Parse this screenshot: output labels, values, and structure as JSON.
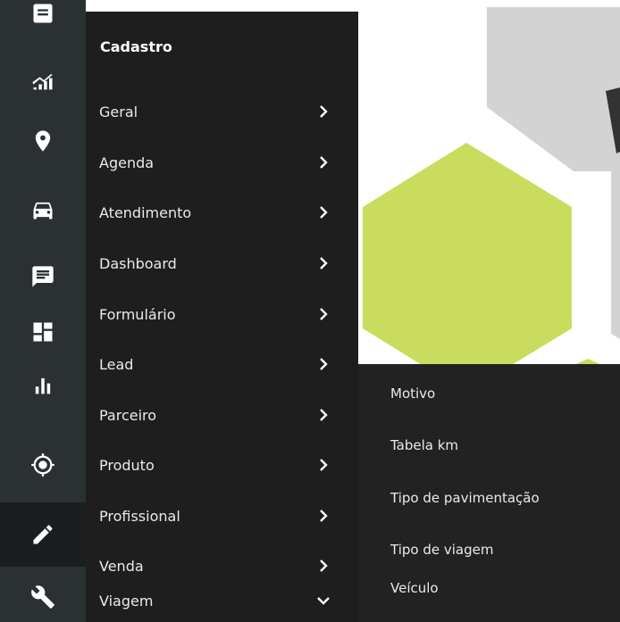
{
  "colors": {
    "rail_bg": "#2b3033",
    "rail_active": "#1b1e20",
    "menu_bg": "#1e1e1e",
    "flyout_bg": "#222222",
    "hex_gray": "#d3d3d3",
    "hex_green": "#c9dc5e",
    "hex_dark": "#333333"
  },
  "rail": {
    "items": [
      {
        "icon": "document-icon"
      },
      {
        "icon": "signal-icon"
      },
      {
        "icon": "map-pin-icon"
      },
      {
        "icon": "car-icon"
      },
      {
        "icon": "chat-icon"
      },
      {
        "icon": "dashboard-icon"
      },
      {
        "icon": "bar-chart-icon"
      },
      {
        "icon": "target-icon"
      },
      {
        "icon": "pencil-icon",
        "active": true
      },
      {
        "icon": "wrench-icon"
      }
    ]
  },
  "menu": {
    "title": "Cadastro",
    "items": [
      {
        "label": "Geral",
        "chevron": "right"
      },
      {
        "label": "Agenda",
        "chevron": "right"
      },
      {
        "label": "Atendimento",
        "chevron": "right"
      },
      {
        "label": "Dashboard",
        "chevron": "right"
      },
      {
        "label": "Formulário",
        "chevron": "right"
      },
      {
        "label": "Lead",
        "chevron": "right"
      },
      {
        "label": "Parceiro",
        "chevron": "right"
      },
      {
        "label": "Produto",
        "chevron": "right"
      },
      {
        "label": "Profissional",
        "chevron": "right"
      },
      {
        "label": "Venda",
        "chevron": "right"
      },
      {
        "label": "Viagem",
        "chevron": "down"
      }
    ]
  },
  "flyout": {
    "items": [
      {
        "label": "Motivo"
      },
      {
        "label": "Tabela km"
      },
      {
        "label": "Tipo de pavimentação"
      },
      {
        "label": "Tipo de viagem"
      },
      {
        "label": "Veículo"
      }
    ]
  }
}
